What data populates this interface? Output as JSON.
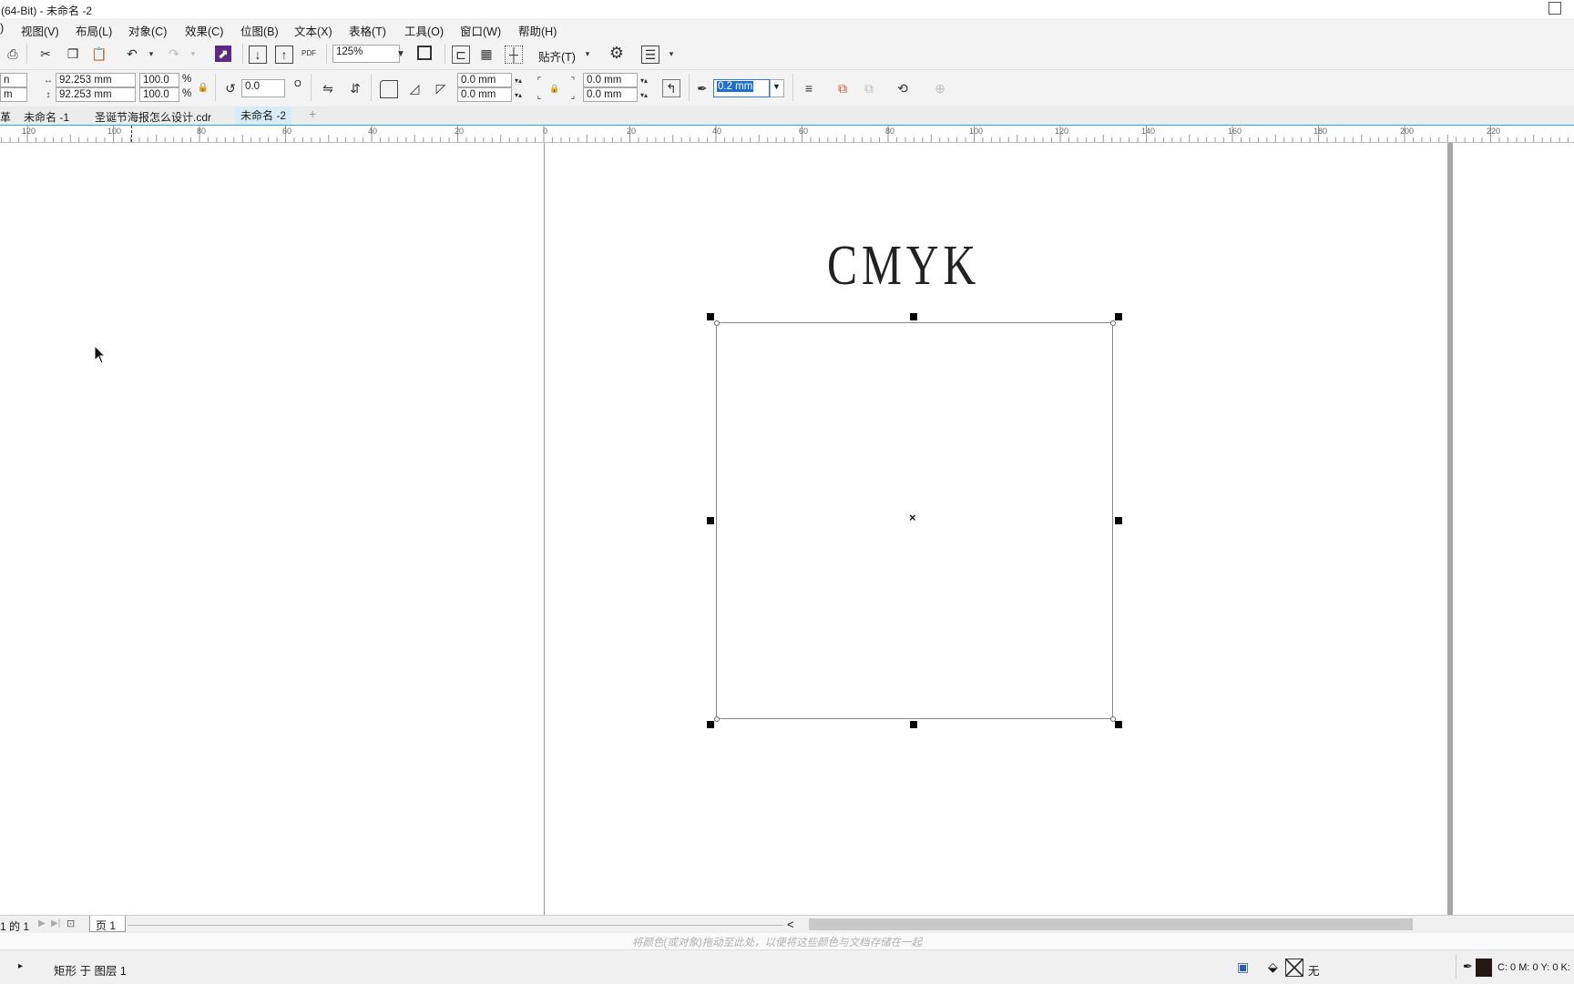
{
  "window": {
    "title": "(64-Bit) - 未命名 -2"
  },
  "menu": [
    "视图(V)",
    "布局(L)",
    "对象(C)",
    "效果(C)",
    "位图(B)",
    "文本(X)",
    "表格(T)",
    "工具(O)",
    "窗口(W)",
    "帮助(H)"
  ],
  "menu_partial": ")",
  "toolbar1": {
    "zoom": "125%",
    "snap_label": "贴齐(T)",
    "pdf_label": "PDF"
  },
  "toolbar2": {
    "x_tail": "n",
    "y_tail": "m",
    "width": "92.253 mm",
    "height": "92.253 mm",
    "scale_w": "100.0",
    "scale_h": "100.0",
    "pct1": "%",
    "pct2": "%",
    "rotation": "0.0",
    "degree": "O",
    "corner1": "0.0 mm",
    "corner2": "0.0 mm",
    "corner3": "0.0 mm",
    "corner4": "0.0 mm",
    "outline_width": "0.2 mm"
  },
  "tabs": {
    "partial": "革",
    "items": [
      "未命名 -1",
      "圣诞节海报怎么设计.cdr",
      "未命名 -2"
    ],
    "add": "+"
  },
  "ruler": {
    "labels": [
      "120",
      "100",
      "80",
      "60",
      "40",
      "20",
      "0",
      "20",
      "40",
      "60",
      "80",
      "100",
      "120",
      "140",
      "160",
      "180",
      "200",
      "220"
    ]
  },
  "canvas": {
    "heading": "CMYK"
  },
  "pagebar": {
    "nav_text": "1  的  1",
    "page_tab": "页 1",
    "scroll_left": "<"
  },
  "colorbar": {
    "hint": "将颜色(或对象)拖动至此处，以便将这些颜色与文档存储在一起"
  },
  "status": {
    "object_info": "矩形 于 图层 1",
    "fill": "无",
    "outline_color": "C: 0 M: 0 Y: 0 K:"
  }
}
